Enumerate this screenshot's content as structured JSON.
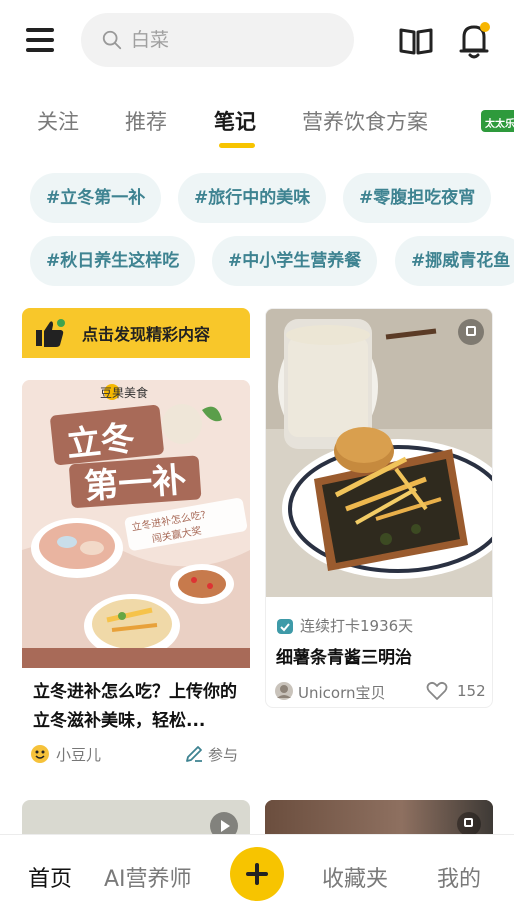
{
  "search": {
    "placeholder": "白菜"
  },
  "tabs": [
    {
      "label": "关注",
      "active": false
    },
    {
      "label": "推荐",
      "active": false
    },
    {
      "label": "笔记",
      "active": true
    },
    {
      "label": "营养饮食方案",
      "active": false
    }
  ],
  "tab_partner_logo": "太太乐",
  "topics": [
    "#立冬第一补",
    "#旅行中的美味",
    "#零腹担吃夜宵",
    "#秋日养生这样吃",
    "#中小学生营养餐",
    "#挪威青花鱼"
  ],
  "banner": {
    "label": "点击发现精彩内容"
  },
  "cards": [
    {
      "poster": {
        "brand": "豆果美食",
        "headline_line1": "立冬",
        "headline_line2": "第一补",
        "tagline_line1": "立冬进补怎么吃?",
        "tagline_line2": "闯关赢大奖"
      },
      "title": "立冬进补怎么吃？上传你的立冬滋补美味，轻松...",
      "author": "小豆儿",
      "action": "参与"
    },
    {
      "streak": "连续打卡1936天",
      "title": "细薯条青酱三明治",
      "author": "Unicorn宝贝",
      "likes": "152"
    }
  ],
  "bottom_nav": {
    "home": "首页",
    "ai": "AI营养师",
    "favorites": "收藏夹",
    "me": "我的"
  },
  "colors": {
    "accent": "#f7c400",
    "chip_bg": "#eef5f6",
    "chip_text": "#3e8391",
    "notification_dot": "#f7b500"
  }
}
